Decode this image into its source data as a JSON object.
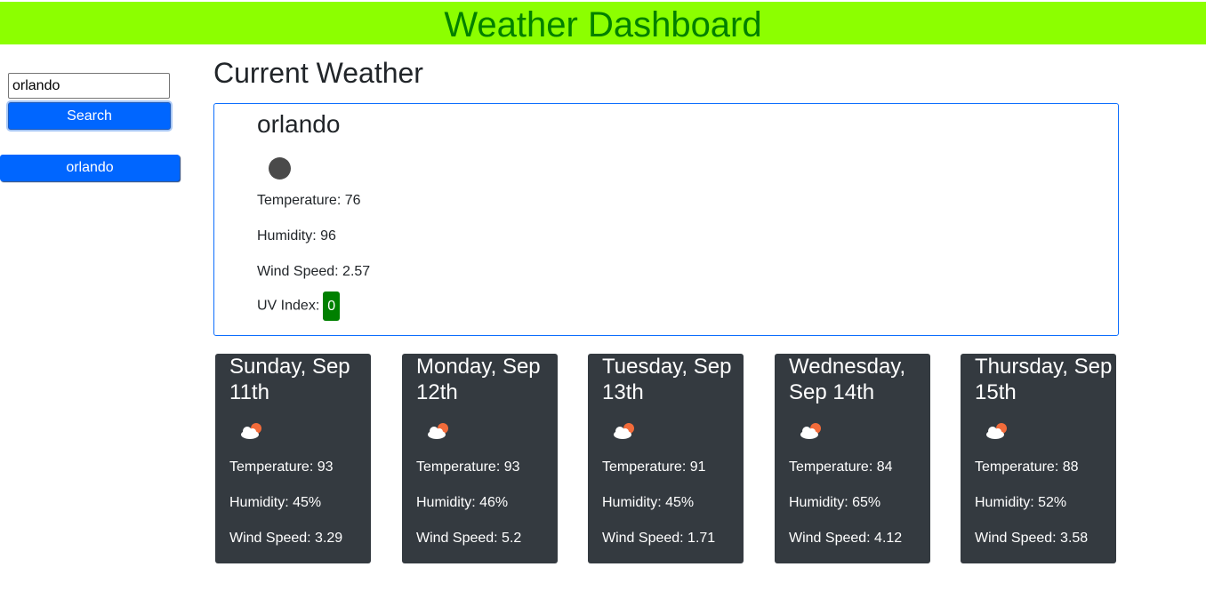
{
  "header": {
    "title": "Weather Dashboard"
  },
  "search": {
    "value": "orlando",
    "button_label": "Search"
  },
  "history": [
    {
      "label": "orlando"
    }
  ],
  "current": {
    "section_title": "Current Weather",
    "city": "orlando",
    "icon": "dark-circle-weather-icon",
    "temperature": "Temperature: 76",
    "humidity": "Humidity: 96",
    "wind": "Wind Speed: 2.57",
    "uv_label": "UV Index:",
    "uv_value": "0",
    "uv_color": "#008000"
  },
  "forecast": [
    {
      "date": "Sunday, Sep 11th",
      "icon": "partly-cloudy-icon",
      "temperature": "Temperature: 93",
      "humidity": "Humidity: 45%",
      "wind": "Wind Speed: 3.29"
    },
    {
      "date": "Monday, Sep 12th",
      "icon": "partly-cloudy-icon",
      "temperature": "Temperature: 93",
      "humidity": "Humidity: 46%",
      "wind": "Wind Speed: 5.2"
    },
    {
      "date": "Tuesday, Sep 13th",
      "icon": "partly-cloudy-icon",
      "temperature": "Temperature: 91",
      "humidity": "Humidity: 45%",
      "wind": "Wind Speed: 1.71"
    },
    {
      "date": "Wednesday, Sep 14th",
      "icon": "partly-cloudy-icon",
      "temperature": "Temperature: 84",
      "humidity": "Humidity: 65%",
      "wind": "Wind Speed: 4.12"
    },
    {
      "date": "Thursday, Sep 15th",
      "icon": "partly-cloudy-icon",
      "temperature": "Temperature: 88",
      "humidity": "Humidity: 52%",
      "wind": "Wind Speed: 3.58"
    }
  ],
  "colors": {
    "header_bg": "#8cff00",
    "header_text": "#008000",
    "button_blue": "#0066ff",
    "card_bg": "#343a40"
  }
}
